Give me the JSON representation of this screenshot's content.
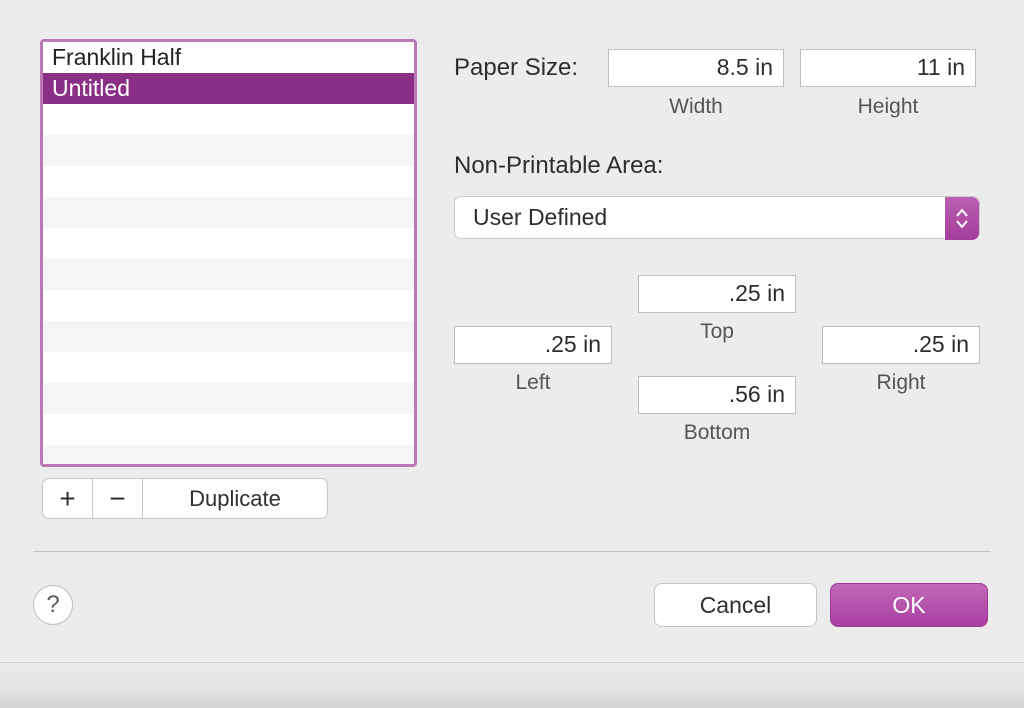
{
  "paper_sizes": {
    "items": [
      "Franklin Half",
      "Untitled"
    ],
    "selected_index": 1
  },
  "controls": {
    "add": "+",
    "remove": "−",
    "duplicate": "Duplicate"
  },
  "paper_size_section": {
    "label": "Paper Size:",
    "width_value": "8.5 in",
    "width_label": "Width",
    "height_value": "11 in",
    "height_label": "Height"
  },
  "non_printable": {
    "label": "Non-Printable Area:",
    "preset": "User Defined",
    "top_value": ".25 in",
    "top_label": "Top",
    "left_value": ".25 in",
    "left_label": "Left",
    "right_value": ".25 in",
    "right_label": "Right",
    "bottom_value": ".56 in",
    "bottom_label": "Bottom"
  },
  "footer": {
    "help": "?",
    "cancel": "Cancel",
    "ok": "OK"
  },
  "colors": {
    "accent": "#a93fa1",
    "selection": "#8a2f86"
  }
}
